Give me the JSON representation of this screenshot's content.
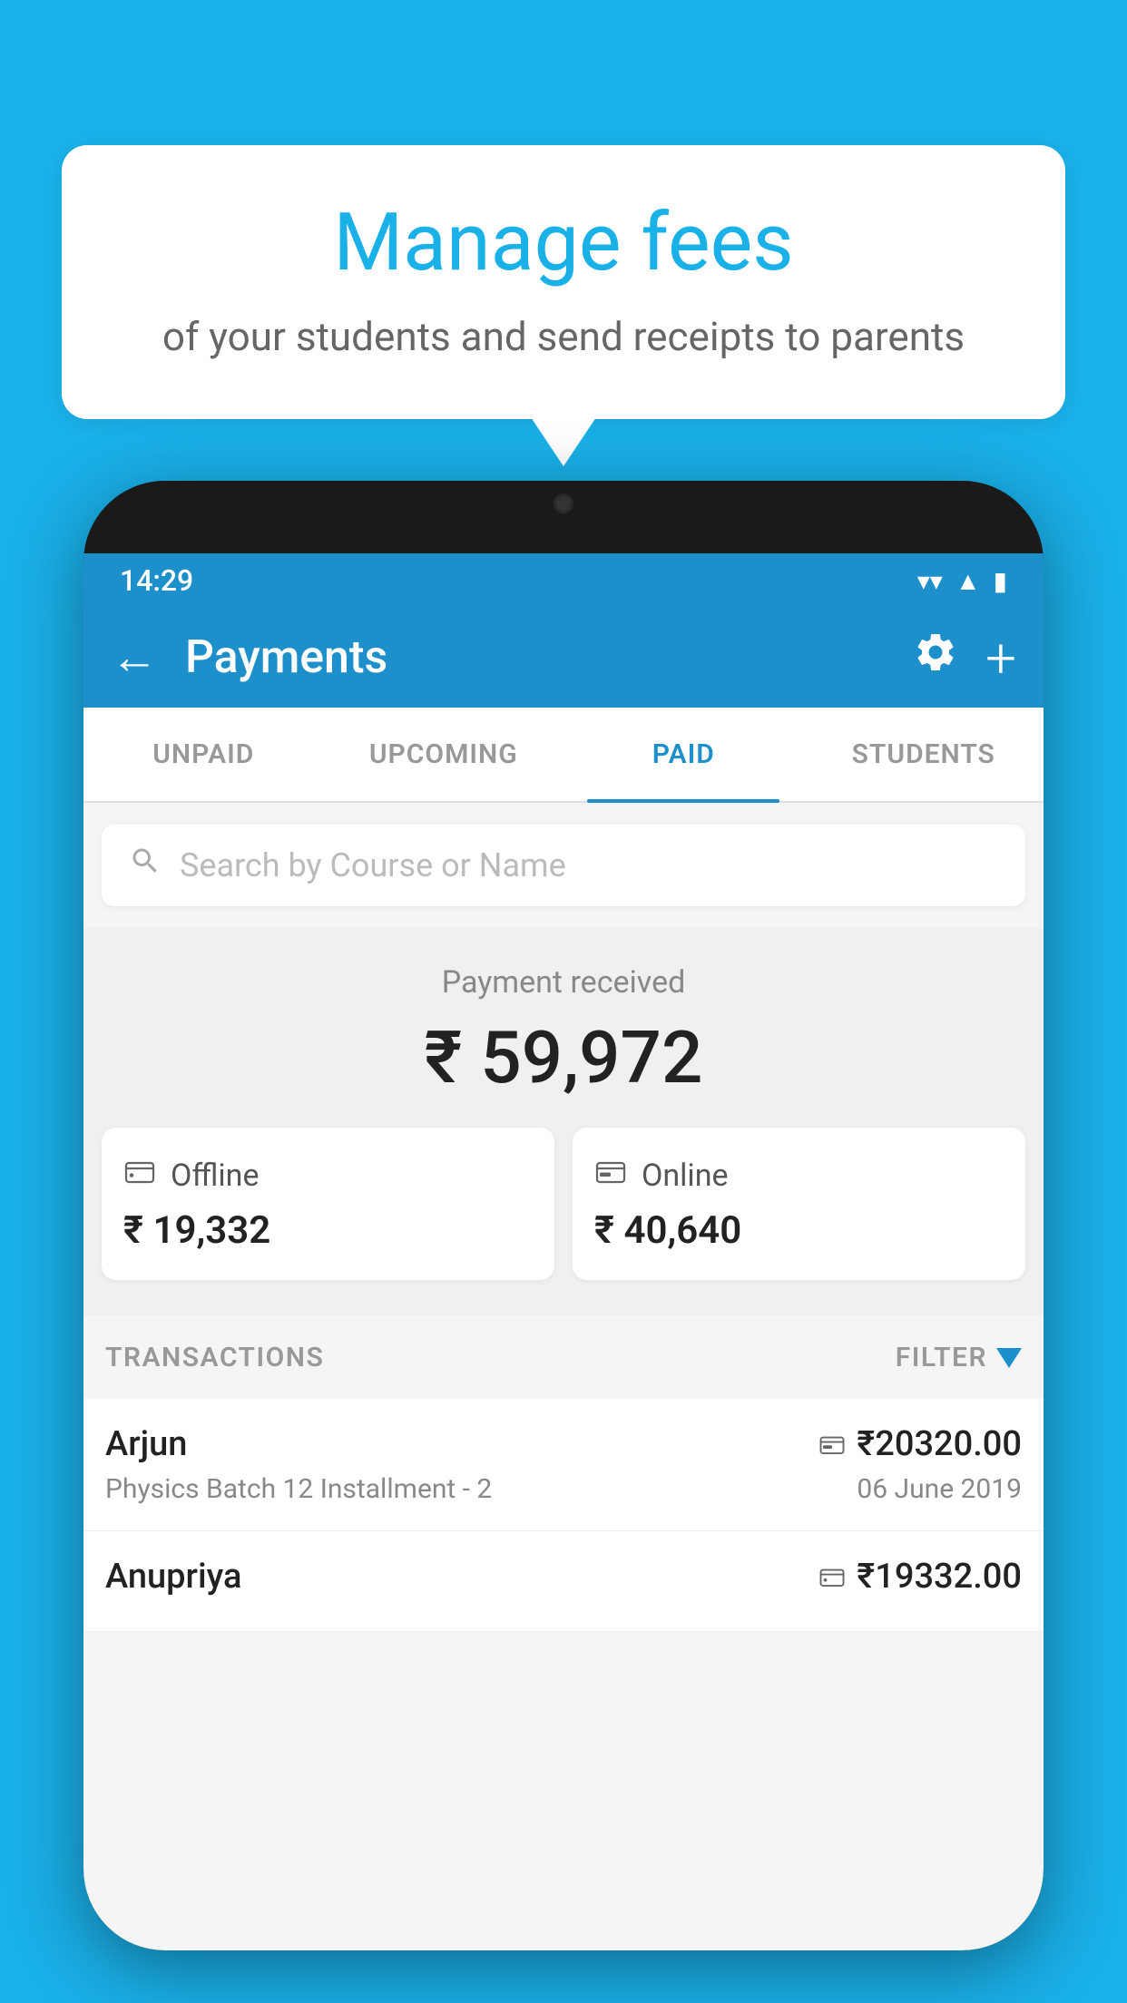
{
  "background_color": "#1ab0e8",
  "speech_bubble": {
    "title": "Manage fees",
    "subtitle": "of your students and send receipts to parents"
  },
  "status_bar": {
    "time": "14:29",
    "icons": [
      "wifi",
      "signal",
      "battery"
    ]
  },
  "app_bar": {
    "title": "Payments",
    "back_icon": "←",
    "gear_icon": "⚙",
    "plus_icon": "+"
  },
  "tabs": [
    {
      "label": "UNPAID",
      "active": false
    },
    {
      "label": "UPCOMING",
      "active": false
    },
    {
      "label": "PAID",
      "active": true
    },
    {
      "label": "STUDENTS",
      "active": false
    }
  ],
  "search": {
    "placeholder": "Search by Course or Name"
  },
  "payment_summary": {
    "label": "Payment received",
    "total": "₹ 59,972",
    "offline": {
      "icon": "offline",
      "label": "Offline",
      "amount": "₹ 19,332"
    },
    "online": {
      "icon": "online",
      "label": "Online",
      "amount": "₹ 40,640"
    }
  },
  "transactions_header": {
    "label": "TRANSACTIONS",
    "filter_label": "FILTER"
  },
  "transactions": [
    {
      "name": "Arjun",
      "course": "Physics Batch 12 Installment - 2",
      "amount": "₹20320.00",
      "date": "06 June 2019",
      "payment_type": "online"
    },
    {
      "name": "Anupriya",
      "course": "",
      "amount": "₹19332.00",
      "date": "",
      "payment_type": "offline"
    }
  ]
}
